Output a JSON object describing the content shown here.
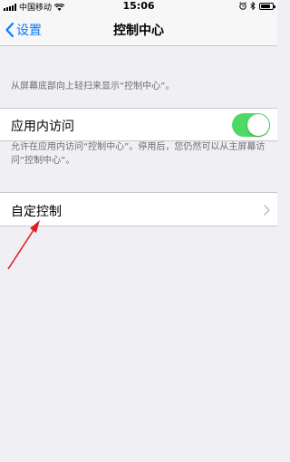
{
  "status_bar": {
    "carrier": "中国移动",
    "time": "15:06",
    "battery_level": 0.85,
    "icons": [
      "signal-icon",
      "wifi-icon",
      "alarm-icon",
      "bluetooth-icon",
      "battery-icon"
    ]
  },
  "nav": {
    "back_label": "设置",
    "title": "控制中心"
  },
  "section1": {
    "description": "从屏幕底部向上轻扫来显示“控制中心”。"
  },
  "in_app_access": {
    "label": "应用内访问",
    "enabled": true,
    "description": "允许在应用内访问“控制中心”。停用后，您仍然可以从主屏幕访问“控制中心”。"
  },
  "customize": {
    "label": "自定控制"
  },
  "colors": {
    "accent": "#0a7aff",
    "toggle_on": "#4cd964",
    "annotation_arrow": "#e02020"
  }
}
